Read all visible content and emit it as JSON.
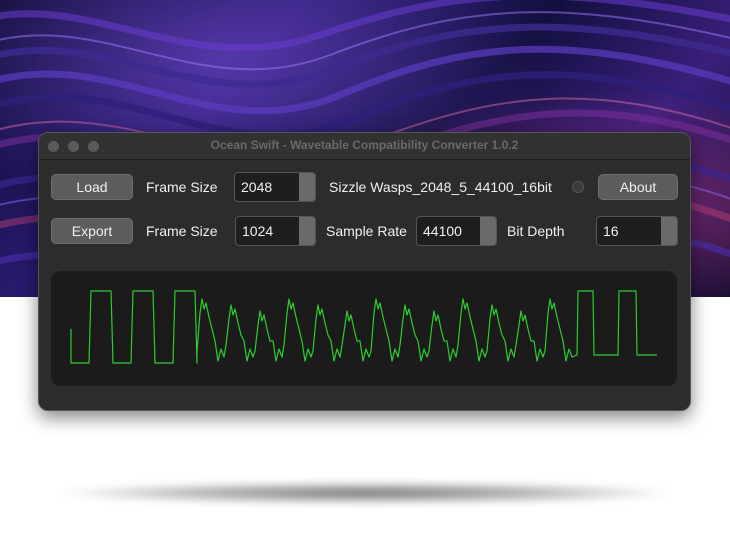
{
  "window": {
    "title": "Ocean Swift - Wavetable Compatibility Converter 1.0.2"
  },
  "toolbar": {
    "load_label": "Load",
    "export_label": "Export",
    "about_label": "About"
  },
  "input_row": {
    "frame_size_label": "Frame Size",
    "frame_size_value": "2048",
    "file_name": "Sizzle Wasps_2048_5_44100_16bit"
  },
  "output_row": {
    "frame_size_label": "Frame Size",
    "frame_size_value": "1024",
    "sample_rate_label": "Sample Rate",
    "sample_rate_value": "44100",
    "bit_depth_label": "Bit Depth",
    "bit_depth_value": "16"
  },
  "waveform": {
    "color": "#2ecc2e"
  },
  "icons": [
    "traffic-close-icon",
    "traffic-minimize-icon",
    "traffic-zoom-icon",
    "status-indicator-icon"
  ]
}
